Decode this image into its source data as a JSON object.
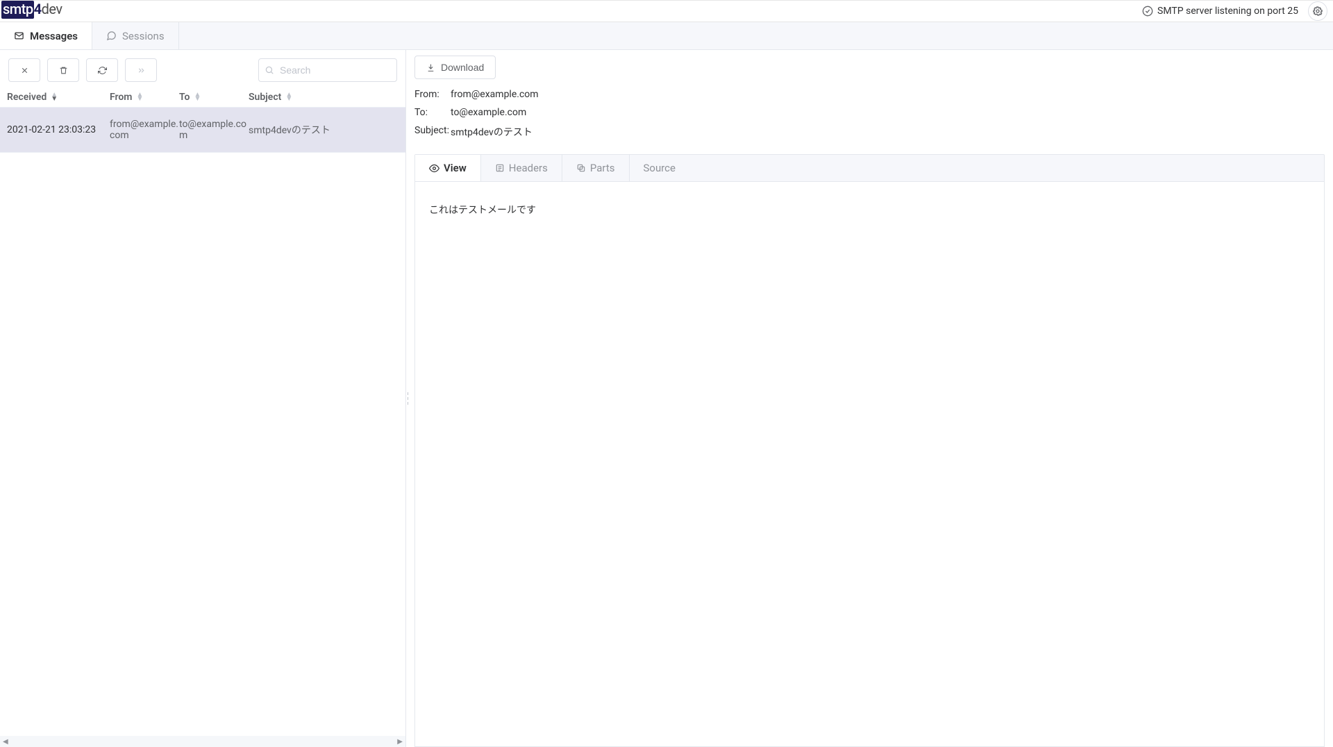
{
  "header": {
    "logo_smtp": "smtp",
    "logo_4": "4",
    "logo_dev": "dev",
    "status_text": "SMTP server listening on port 25"
  },
  "main_tabs": {
    "messages": "Messages",
    "sessions": "Sessions"
  },
  "left": {
    "search_placeholder": "Search",
    "columns": {
      "received": "Received",
      "from": "From",
      "to": "To",
      "subject": "Subject"
    },
    "rows": [
      {
        "received": "2021-02-21 23:03:23",
        "from": "from@example.com",
        "to": "to@example.com",
        "subject": "smtp4devのテスト"
      }
    ]
  },
  "detail": {
    "download": "Download",
    "labels": {
      "from": "From:",
      "to": "To:",
      "subject": "Subject:"
    },
    "from": "from@example.com",
    "to": "to@example.com",
    "subject": "smtp4devのテスト",
    "tabs": {
      "view": "View",
      "headers": "Headers",
      "parts": "Parts",
      "source": "Source"
    },
    "body": "これはテストメールです"
  }
}
